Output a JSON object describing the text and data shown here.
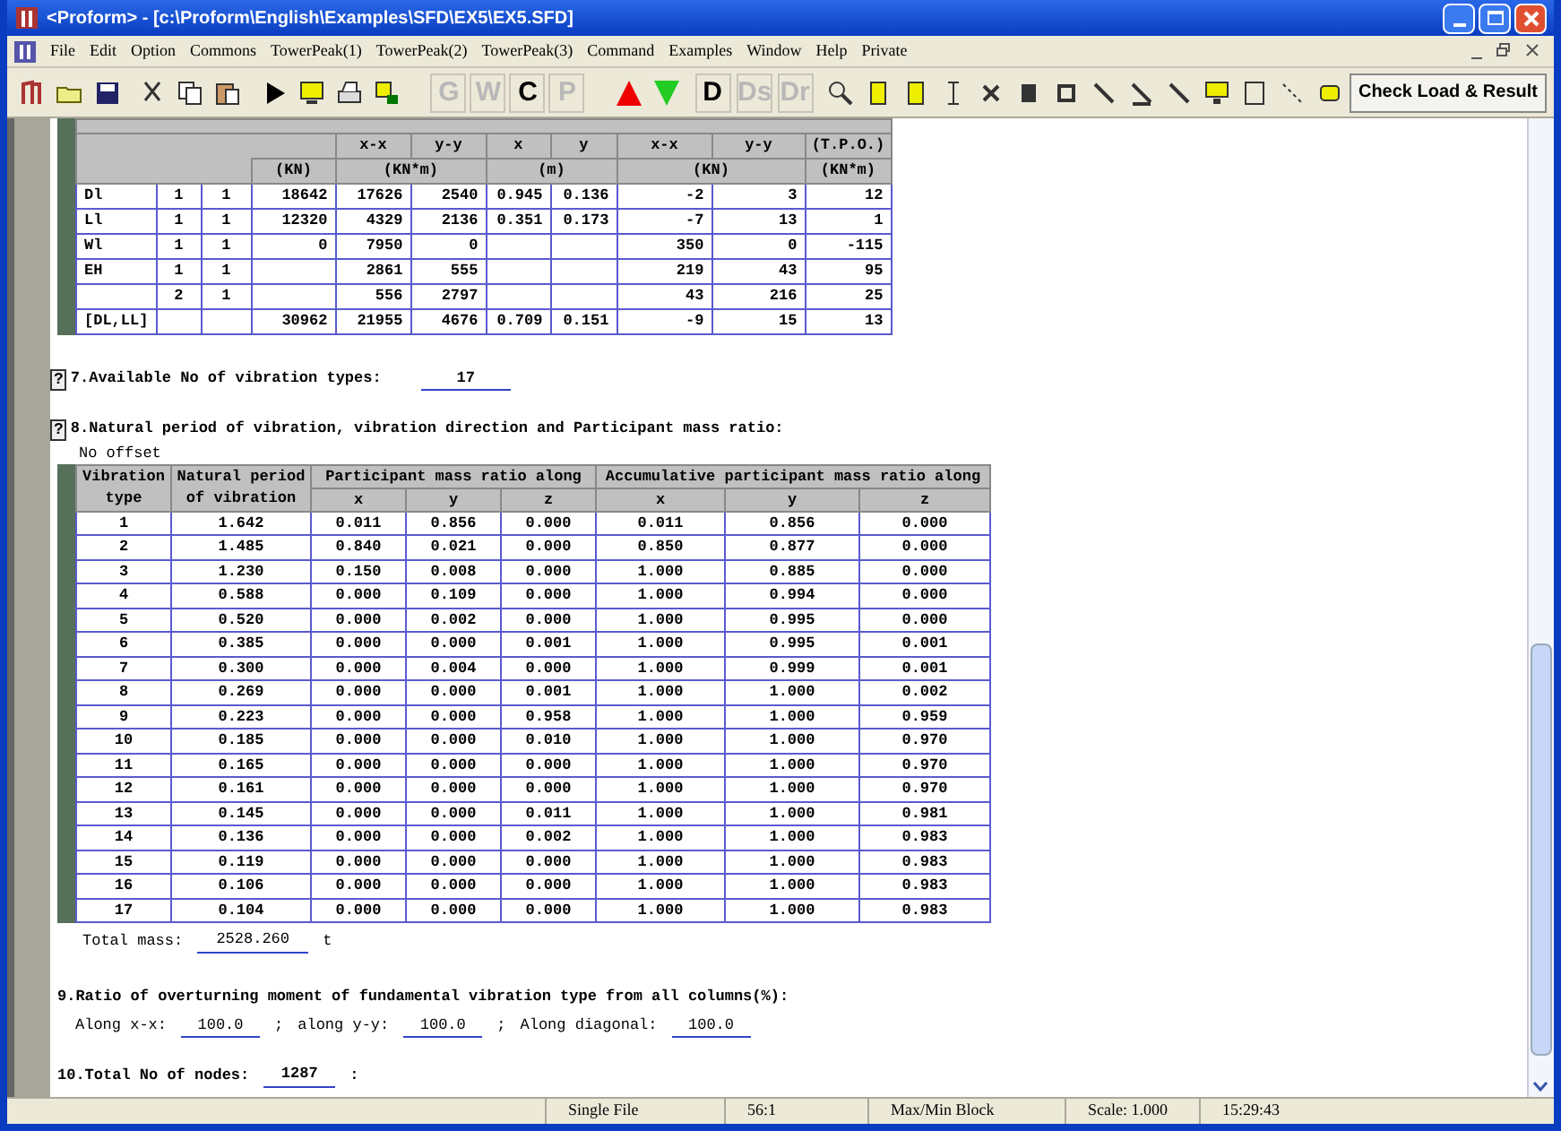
{
  "window": {
    "title": "<Proform> - [c:\\Proform\\English\\Examples\\SFD\\EX5\\EX5.SFD]"
  },
  "menu": [
    "File",
    "Edit",
    "Option",
    "Commons",
    "TowerPeak(1)",
    "TowerPeak(2)",
    "TowerPeak(3)",
    "Command",
    "Examples",
    "Window",
    "Help",
    "Private"
  ],
  "toolbar": {
    "letter_buttons": [
      {
        "label": "G",
        "disabled": true
      },
      {
        "label": "W",
        "disabled": true
      },
      {
        "label": "C",
        "disabled": false
      },
      {
        "label": "P",
        "disabled": true
      }
    ],
    "d_buttons": [
      {
        "label": "D",
        "disabled": false
      },
      {
        "label": "Ds",
        "disabled": true
      },
      {
        "label": "Dr",
        "disabled": true
      }
    ],
    "check_button": "Check Load & Result"
  },
  "load_table": {
    "subheaders": [
      "x-x",
      "y-y",
      "x",
      "y",
      "x-x",
      "y-y",
      "(T.P.O.)"
    ],
    "units": [
      "(KN)",
      "(KN*m)",
      "(m)",
      "(KN)",
      "(KN*m)"
    ],
    "rows": [
      [
        "Dl",
        "1",
        "1",
        "18642",
        "17626",
        "2540",
        "0.945",
        "0.136",
        "-2",
        "3",
        "12"
      ],
      [
        "Ll",
        "1",
        "1",
        "12320",
        "4329",
        "2136",
        "0.351",
        "0.173",
        "-7",
        "13",
        "1"
      ],
      [
        "Wl",
        "1",
        "1",
        "0",
        "7950",
        "0",
        null,
        null,
        "350",
        "0",
        "-115"
      ],
      [
        "EH",
        "1",
        "1",
        null,
        "2861",
        "555",
        null,
        null,
        "219",
        "43",
        "95"
      ],
      [
        null,
        "2",
        "1",
        null,
        "556",
        "2797",
        null,
        null,
        "43",
        "216",
        "25"
      ],
      [
        "[DL,LL]",
        null,
        null,
        "30962",
        "21955",
        "4676",
        "0.709",
        "0.151",
        "-9",
        "15",
        "13"
      ]
    ]
  },
  "section_7": {
    "help": "?",
    "title": "7.Available No of vibration types:",
    "value": "17"
  },
  "section_8": {
    "help": "?",
    "title": "8.Natural period of vibration, vibration direction and Participant mass ratio:",
    "note": "No offset",
    "headers": [
      "Vibration type",
      "Natural period of vibration",
      "Participant mass ratio along",
      "Accumulative participant mass ratio along"
    ],
    "subheaders": [
      "x",
      "y",
      "z",
      "x",
      "y",
      "z"
    ],
    "rows": [
      [
        "1",
        "1.642",
        "0.011",
        "0.856",
        "0.000",
        "0.011",
        "0.856",
        "0.000"
      ],
      [
        "2",
        "1.485",
        "0.840",
        "0.021",
        "0.000",
        "0.850",
        "0.877",
        "0.000"
      ],
      [
        "3",
        "1.230",
        "0.150",
        "0.008",
        "0.000",
        "1.000",
        "0.885",
        "0.000"
      ],
      [
        "4",
        "0.588",
        "0.000",
        "0.109",
        "0.000",
        "1.000",
        "0.994",
        "0.000"
      ],
      [
        "5",
        "0.520",
        "0.000",
        "0.002",
        "0.000",
        "1.000",
        "0.995",
        "0.000"
      ],
      [
        "6",
        "0.385",
        "0.000",
        "0.000",
        "0.001",
        "1.000",
        "0.995",
        "0.001"
      ],
      [
        "7",
        "0.300",
        "0.000",
        "0.004",
        "0.000",
        "1.000",
        "0.999",
        "0.001"
      ],
      [
        "8",
        "0.269",
        "0.000",
        "0.000",
        "0.001",
        "1.000",
        "1.000",
        "0.002"
      ],
      [
        "9",
        "0.223",
        "0.000",
        "0.000",
        "0.958",
        "1.000",
        "1.000",
        "0.959"
      ],
      [
        "10",
        "0.185",
        "0.000",
        "0.000",
        "0.010",
        "1.000",
        "1.000",
        "0.970"
      ],
      [
        "11",
        "0.165",
        "0.000",
        "0.000",
        "0.000",
        "1.000",
        "1.000",
        "0.970"
      ],
      [
        "12",
        "0.161",
        "0.000",
        "0.000",
        "0.000",
        "1.000",
        "1.000",
        "0.970"
      ],
      [
        "13",
        "0.145",
        "0.000",
        "0.000",
        "0.011",
        "1.000",
        "1.000",
        "0.981"
      ],
      [
        "14",
        "0.136",
        "0.000",
        "0.000",
        "0.002",
        "1.000",
        "1.000",
        "0.983"
      ],
      [
        "15",
        "0.119",
        "0.000",
        "0.000",
        "0.000",
        "1.000",
        "1.000",
        "0.983"
      ],
      [
        "16",
        "0.106",
        "0.000",
        "0.000",
        "0.000",
        "1.000",
        "1.000",
        "0.983"
      ],
      [
        "17",
        "0.104",
        "0.000",
        "0.000",
        "0.000",
        "1.000",
        "1.000",
        "0.983"
      ]
    ],
    "total_label": "Total mass:",
    "total_value": "2528.260",
    "total_unit": "t"
  },
  "section_9": {
    "title": "9.Ratio of overturning moment of fundamental vibration type from all columns(%):",
    "fields": [
      {
        "label": "Along x-x:",
        "value": "100.0",
        "sep": ";"
      },
      {
        "label": "along y-y:",
        "value": "100.0",
        "sep": ";"
      },
      {
        "label": "Along diagonal:",
        "value": "100.0"
      }
    ]
  },
  "section_10": {
    "title": "10.Total No of nodes:",
    "value": "1287",
    "sep": ":"
  },
  "status_bar": [
    "Single File",
    "56:1",
    "Max/Min Block",
    "Scale: 1.000",
    "15:29:43"
  ]
}
